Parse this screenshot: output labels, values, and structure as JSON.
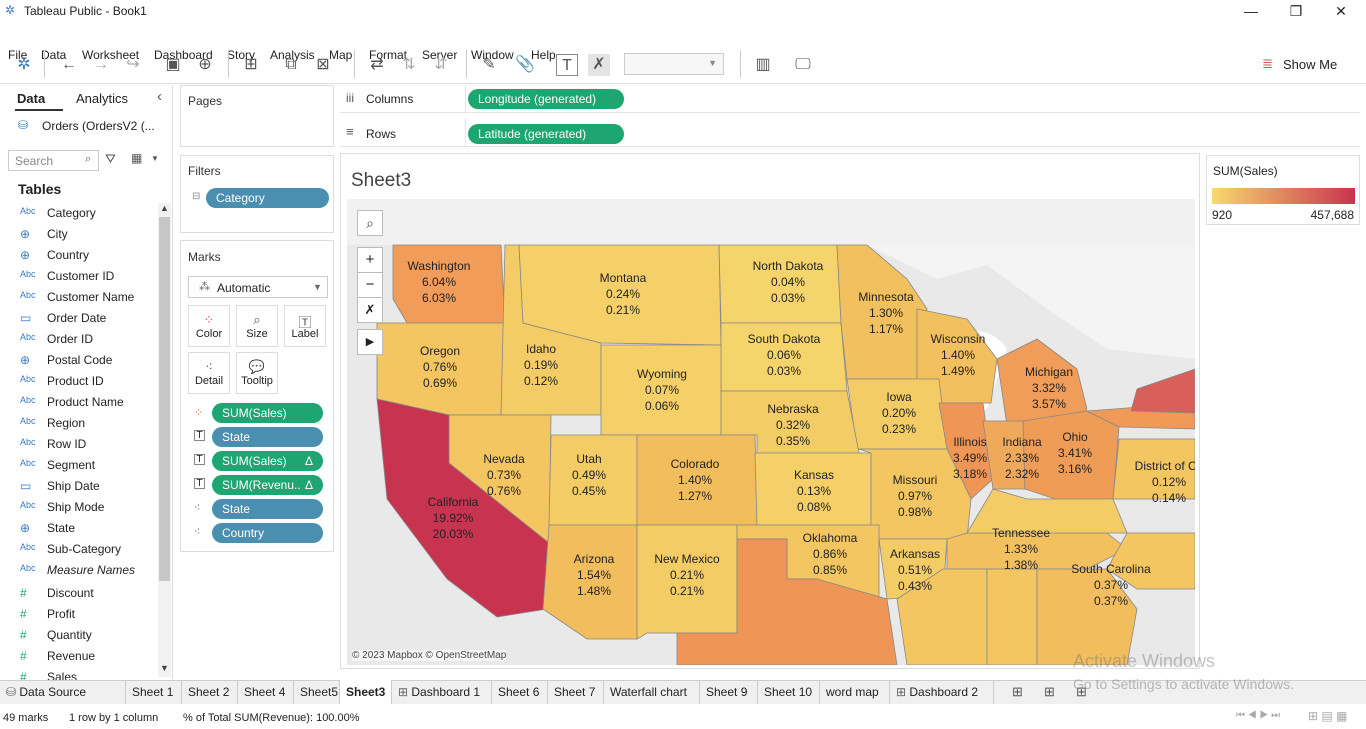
{
  "app": {
    "title": "Tableau Public - Book1"
  },
  "menu": [
    "File",
    "Data",
    "Worksheet",
    "Dashboard",
    "Story",
    "Analysis",
    "Map",
    "Format",
    "Server",
    "Window",
    "Help"
  ],
  "toolbar": {
    "show_me": "Show Me"
  },
  "left": {
    "tab_data": "Data",
    "tab_analytics": "Analytics",
    "datasource": "Orders (OrdersV2 (...",
    "search_placeholder": "Search",
    "tables_label": "Tables",
    "fields": [
      {
        "type": "Abc",
        "name": "Category"
      },
      {
        "type": "geo",
        "name": "City"
      },
      {
        "type": "geo",
        "name": "Country"
      },
      {
        "type": "Abc",
        "name": "Customer ID"
      },
      {
        "type": "Abc",
        "name": "Customer Name"
      },
      {
        "type": "date",
        "name": "Order Date"
      },
      {
        "type": "Abc",
        "name": "Order ID"
      },
      {
        "type": "geo",
        "name": "Postal Code"
      },
      {
        "type": "Abc",
        "name": "Product ID"
      },
      {
        "type": "Abc",
        "name": "Product Name"
      },
      {
        "type": "Abc",
        "name": "Region"
      },
      {
        "type": "Abc",
        "name": "Row ID"
      },
      {
        "type": "Abc",
        "name": "Segment"
      },
      {
        "type": "date",
        "name": "Ship Date"
      },
      {
        "type": "Abc",
        "name": "Ship Mode"
      },
      {
        "type": "geo",
        "name": "State"
      },
      {
        "type": "Abc",
        "name": "Sub-Category"
      },
      {
        "type": "Abc",
        "name": "Measure Names"
      },
      {
        "type": "#",
        "name": "Discount"
      },
      {
        "type": "#",
        "name": "Profit"
      },
      {
        "type": "#",
        "name": "Quantity"
      },
      {
        "type": "#",
        "name": "Revenue"
      },
      {
        "type": "#",
        "name": "Sales"
      }
    ]
  },
  "shelves": {
    "pages": "Pages",
    "columns_label": "Columns",
    "columns_pill": "Longitude (generated)",
    "rows_label": "Rows",
    "rows_pill": "Latitude (generated)",
    "filters": "Filters",
    "filter_pill": "Category",
    "marks": "Marks",
    "mark_type": "Automatic",
    "mark_buttons": [
      "Color",
      "Size",
      "Label",
      "Detail",
      "Tooltip"
    ],
    "mark_pills": [
      "SUM(Sales)",
      "State",
      "SUM(Sales)",
      "SUM(Revenu..",
      "State",
      "Country"
    ]
  },
  "sheet": {
    "title": "Sheet3",
    "attribution": "© 2023 Mapbox © OpenStreetMap"
  },
  "legend": {
    "title": "SUM(Sales)",
    "min": "920",
    "max": "457,688",
    "color_low": "#f7d96e",
    "color_high": "#c8334f"
  },
  "states": [
    {
      "name": "Washington",
      "a": "6.04%",
      "b": "6.03%"
    },
    {
      "name": "Montana",
      "a": "0.24%",
      "b": "0.21%"
    },
    {
      "name": "North Dakota",
      "a": "0.04%",
      "b": "0.03%"
    },
    {
      "name": "Minnesota",
      "a": "1.30%",
      "b": "1.17%"
    },
    {
      "name": "South Dakota",
      "a": "0.06%",
      "b": "0.03%"
    },
    {
      "name": "Wisconsin",
      "a": "1.40%",
      "b": "1.49%"
    },
    {
      "name": "Oregon",
      "a": "0.76%",
      "b": "0.69%"
    },
    {
      "name": "Idaho",
      "a": "0.19%",
      "b": "0.12%"
    },
    {
      "name": "Wyoming",
      "a": "0.07%",
      "b": "0.06%"
    },
    {
      "name": "Michigan",
      "a": "3.32%",
      "b": "3.57%"
    },
    {
      "name": "Iowa",
      "a": "0.20%",
      "b": "0.23%"
    },
    {
      "name": "Nebraska",
      "a": "0.32%",
      "b": "0.35%"
    },
    {
      "name": "Illinois",
      "a": "3.49%",
      "b": "3.18%"
    },
    {
      "name": "Indiana",
      "a": "2.33%",
      "b": "2.32%"
    },
    {
      "name": "Ohio",
      "a": "3.41%",
      "b": "3.16%"
    },
    {
      "name": "Nevada",
      "a": "0.73%",
      "b": "0.76%"
    },
    {
      "name": "Utah",
      "a": "0.49%",
      "b": "0.45%"
    },
    {
      "name": "Colorado",
      "a": "1.40%",
      "b": "1.27%"
    },
    {
      "name": "Kansas",
      "a": "0.13%",
      "b": "0.08%"
    },
    {
      "name": "Missouri",
      "a": "0.97%",
      "b": "0.98%"
    },
    {
      "name": "California",
      "a": "19.92%",
      "b": "20.03%"
    },
    {
      "name": "Oklahoma",
      "a": "0.86%",
      "b": "0.85%"
    },
    {
      "name": "Tennessee",
      "a": "1.33%",
      "b": "1.38%"
    },
    {
      "name": "Arkansas",
      "a": "0.51%",
      "b": "0.43%"
    },
    {
      "name": "Arizona",
      "a": "1.54%",
      "b": "1.48%"
    },
    {
      "name": "New Mexico",
      "a": "0.21%",
      "b": "0.21%"
    },
    {
      "name": "South Carolina",
      "a": "0.37%",
      "b": "0.37%"
    },
    {
      "name": "District of Co",
      "a": "0.12%",
      "b": "0.14%"
    }
  ],
  "sheet_tabs": [
    "Data Source",
    "Sheet 1",
    "Sheet 2",
    "Sheet 4",
    "Sheet5",
    "Sheet3",
    "Dashboard 1",
    "Sheet 6",
    "Sheet 7",
    "Waterfall chart",
    "Sheet 9",
    "Sheet 10",
    "word map",
    "Dashboard 2"
  ],
  "status": {
    "marks": "49 marks",
    "rows": "1 row by 1 column",
    "total": "% of Total SUM(Revenue): 100.00%"
  },
  "watermark": {
    "line1": "Activate Windows",
    "line2": "Go to Settings to activate Windows."
  }
}
